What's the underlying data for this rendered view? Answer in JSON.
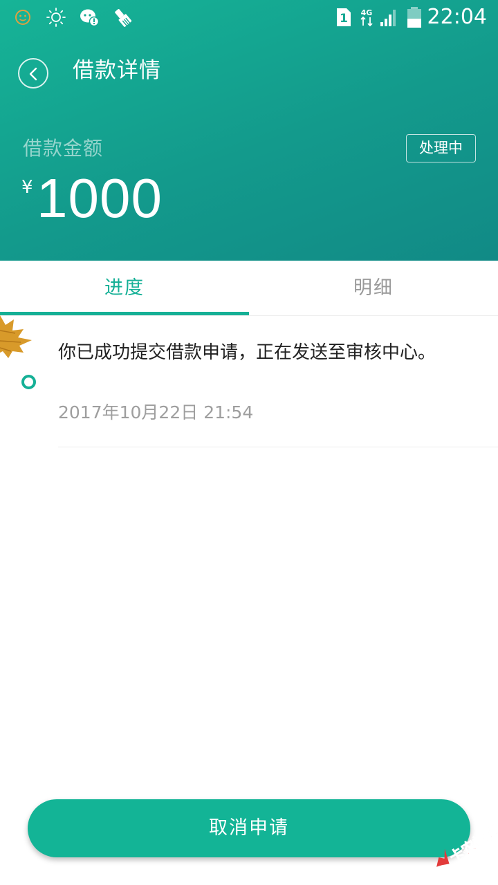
{
  "status_bar": {
    "time": "22:04",
    "sim_slot": "1",
    "network": "4G",
    "icons": [
      "smiley-icon",
      "brightness-icon",
      "chat-alert-icon",
      "brush-icon",
      "sim-icon",
      "network-4g-icon",
      "signal-icon",
      "battery-icon"
    ]
  },
  "header": {
    "title": "借款详情",
    "amount_label": "借款金额",
    "currency": "¥",
    "amount": "1000",
    "status": "处理中"
  },
  "tabs": [
    {
      "label": "进度",
      "active": true
    },
    {
      "label": "明细",
      "active": false
    }
  ],
  "timeline": [
    {
      "text": "你已成功提交借款申请，正在发送至审核中心。",
      "time": "2017年10月22日 21:54"
    }
  ],
  "footer": {
    "cancel_label": "取消申请"
  },
  "watermark": {
    "text": "卡农社区"
  },
  "colors": {
    "accent": "#15b096",
    "header_gradient_start": "#16b497",
    "header_gradient_end": "#118a86",
    "inactive_tab": "#9a9a9a",
    "timestamp": "#9e9e9e",
    "leaf": "#d89a2a",
    "watermark": "#e23b3b"
  }
}
